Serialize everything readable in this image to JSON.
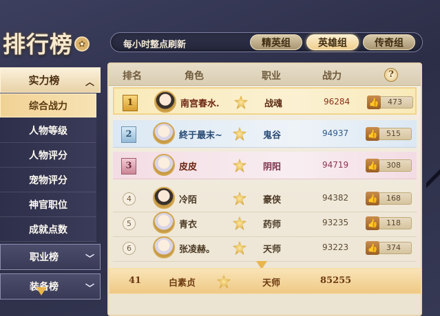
{
  "title": "排行榜",
  "header_bar": {
    "refresh_note": "每小时整点刷新",
    "tabs": [
      {
        "label": "精英组",
        "active": false
      },
      {
        "label": "英雄组",
        "active": true
      },
      {
        "label": "传奇组",
        "active": false
      }
    ]
  },
  "sidebar": {
    "category_open": "实力榜",
    "sub_items": [
      {
        "label": "综合战力",
        "active": true
      },
      {
        "label": "人物等级",
        "active": false
      },
      {
        "label": "人物评分",
        "active": false
      },
      {
        "label": "宠物评分",
        "active": false
      },
      {
        "label": "神官职位",
        "active": false
      },
      {
        "label": "成就点数",
        "active": false
      }
    ],
    "category_job": "职业榜",
    "category_equip": "装备榜"
  },
  "table": {
    "columns": {
      "rank": "排名",
      "role": "角色",
      "job": "职业",
      "power": "战力",
      "help": "?"
    },
    "rows": [
      {
        "rank": "1",
        "name": "南宫春水.",
        "job": "战魂",
        "power": "96284",
        "likes": "473"
      },
      {
        "rank": "2",
        "name": "終于最末~",
        "job": "鬼谷",
        "power": "94937",
        "likes": "515"
      },
      {
        "rank": "3",
        "name": "皮皮",
        "job": "阴阳",
        "power": "94719",
        "likes": "308"
      },
      {
        "rank": "4",
        "name": "冷陌",
        "job": "豪侠",
        "power": "94382",
        "likes": "168"
      },
      {
        "rank": "5",
        "name": "青衣",
        "job": "药师",
        "power": "93235",
        "likes": "118"
      },
      {
        "rank": "6",
        "name": "张凌赫。",
        "job": "天师",
        "power": "93223",
        "likes": "374"
      }
    ]
  },
  "my_rank": {
    "rank": "41",
    "name": "白素贞",
    "job": "天师",
    "power": "85255"
  },
  "colors": {
    "gold": "#f1d48a",
    "accent": "#efc985",
    "background": "#2c2e47"
  }
}
